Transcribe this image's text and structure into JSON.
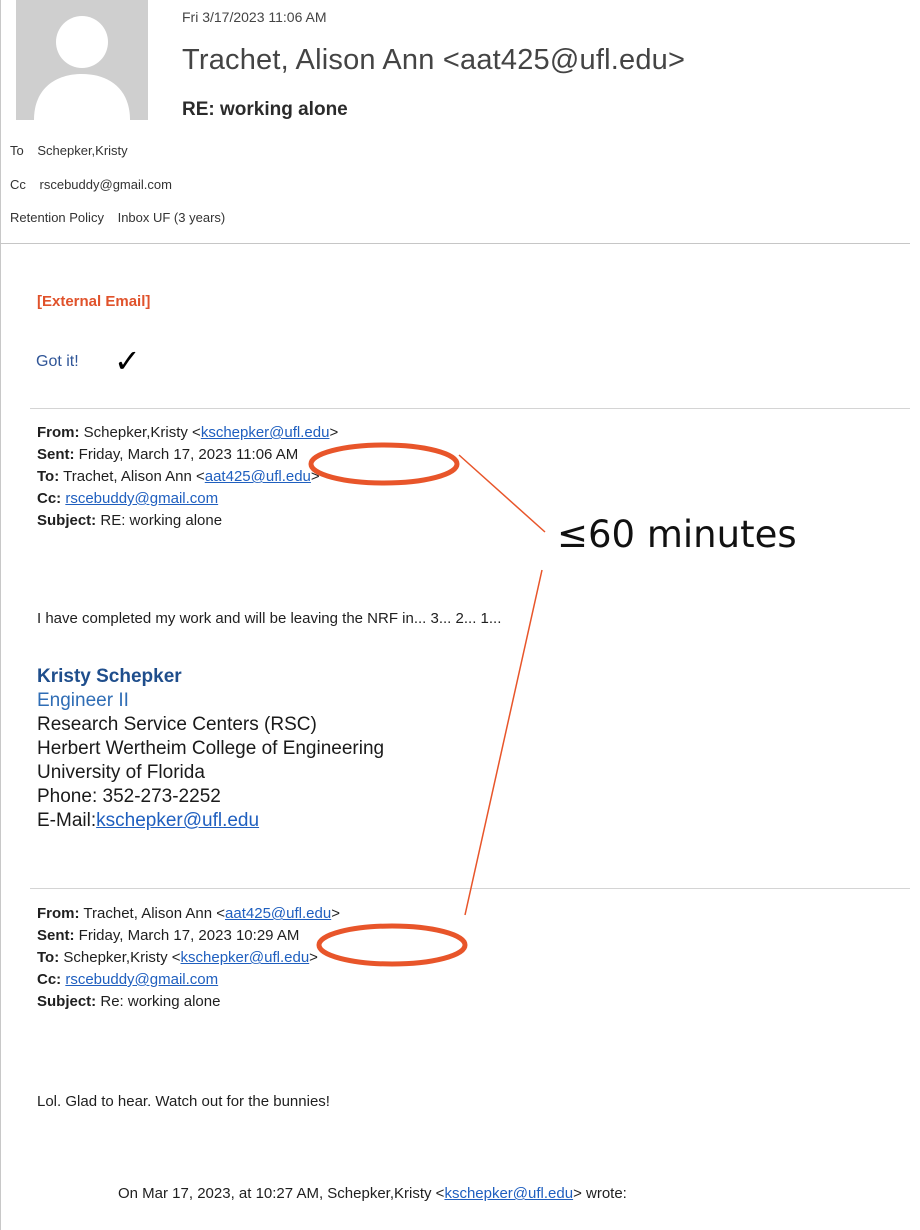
{
  "header": {
    "date": "Fri 3/17/2023 11:06 AM",
    "from": "Trachet, Alison Ann <aat425@ufl.edu>",
    "subject": "RE: working alone",
    "to_label": "To",
    "to_value": "Schepker,Kristy",
    "cc_label": "Cc",
    "cc_value": "rscebuddy@gmail.com",
    "retention_label": "Retention Policy",
    "retention_value": "Inbox UF (3 years)"
  },
  "body": {
    "external_tag": "[External Email]",
    "reply": "Got it!",
    "checkmark": "✓"
  },
  "message1": {
    "from_label": "From:",
    "from_name": "Schepker,Kristy <",
    "from_email": "kschepker@ufl.edu",
    "from_tail": ">",
    "sent_label": "Sent:",
    "sent_value": "Friday, March 17, 2023 11:06 AM",
    "to_label": "To:",
    "to_name": "Trachet, Alison Ann <",
    "to_email": "aat425@ufl.edu",
    "to_tail": ">",
    "cc_label": "Cc:",
    "cc_email": "rscebuddy@gmail.com",
    "subject_label": "Subject:",
    "subject_value": "RE: working alone",
    "text": "I have completed my work and will be leaving the NRF in... 3... 2... 1..."
  },
  "signature": {
    "name": "Kristy Schepker",
    "title": "Engineer II",
    "line1": "Research Service Centers (RSC)",
    "line2": "Herbert Wertheim College of Engineering",
    "line3": "University of Florida",
    "phone": "Phone: 352-273-2252",
    "email_label": "E-Mail:",
    "email": "kschepker@ufl.edu"
  },
  "message2": {
    "from_label": "From:",
    "from_name": "Trachet, Alison Ann <",
    "from_email": "aat425@ufl.edu",
    "from_tail": ">",
    "sent_label": "Sent:",
    "sent_value": "Friday, March 17, 2023 10:29 AM",
    "to_label": "To:",
    "to_name": "Schepker,Kristy <",
    "to_email": "kschepker@ufl.edu",
    "to_tail": ">",
    "cc_label": "Cc:",
    "cc_email": "rscebuddy@gmail.com",
    "subject_label": "Subject:",
    "subject_value": "Re: working alone",
    "text": "Lol.  Glad to hear.  Watch out for the bunnies!"
  },
  "quote": {
    "lead": "On Mar 17, 2023, at 10:27 AM, Schepker,Kristy <",
    "email": "kschepker@ufl.edu",
    "tail": "> wrote:"
  },
  "annotation": {
    "text": "≤60 minutes",
    "color": "#e8552a"
  },
  "colors": {
    "link": "#1f5fbf",
    "external": "#e0522b",
    "reply": "#2f5597",
    "highlight": "#e8552a"
  }
}
